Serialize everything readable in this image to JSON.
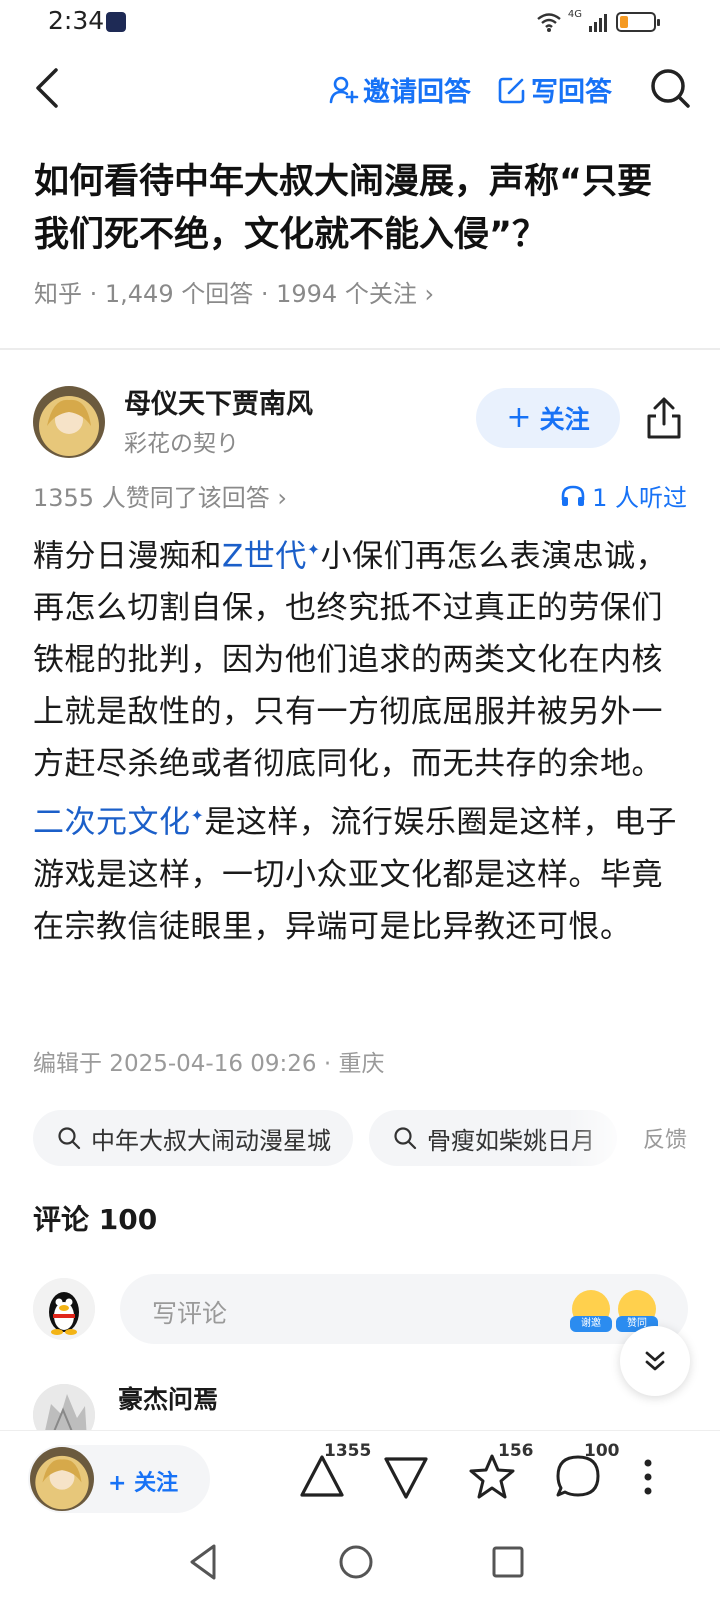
{
  "status_bar": {
    "time": "2:34",
    "network": "4G",
    "battery_level": 0.25
  },
  "nav": {
    "invite_label": "邀请回答",
    "write_label": "写回答"
  },
  "question": {
    "title": "如何看待中年大叔大闹漫展，声称“只要我们死不绝，文化就不能入侵”？",
    "meta": "知乎 · 1,449 个回答 · 1994 个关注 ›"
  },
  "author": {
    "name": "母仪天下贾南风",
    "bio": "彩花の契り",
    "follow_label": "关注"
  },
  "answer": {
    "vote_summary": "1355 人赞同了该回答 ›",
    "listen_text": "1 人听过",
    "body": {
      "p1": "精分日漫痴和",
      "link1": "Z世代",
      "p2": "小保们再怎么表演忠诚，再怎么切割自保，也终究抵不过真正的劳保们铁棍的批判，因为他们追求的两类文化在内核上就是敌性的，只有一方彻底屈服并被另外一方赶尽杀绝或者彻底同化，而无共存的余地。",
      "link2": "二次元文化",
      "p3": "是这样，流行娱乐圈是这样，电子游戏是这样，一切小众亚文化都是这样。毕竟在宗教信徒眼里，异端可是比异教还可恨。"
    },
    "edit_info": "编辑于 2025-04-16 09:26 · 重庆"
  },
  "related": {
    "chips": [
      "中年大叔大闹动漫星城",
      "骨瘦如柴姚日月"
    ],
    "feedback_label": "反馈"
  },
  "comments": {
    "header": "评论 100",
    "placeholder": "写评论",
    "emoji_thanks": "谢邀",
    "emoji_agree": "赞同",
    "first_commenter": "豪杰问焉"
  },
  "bottom_bar": {
    "follow_label": "关注",
    "upvote_count": "1355",
    "favorite_count": "156",
    "comment_count": "100"
  },
  "colors": {
    "accent": "#1772f6",
    "link": "#1b5fc9"
  }
}
